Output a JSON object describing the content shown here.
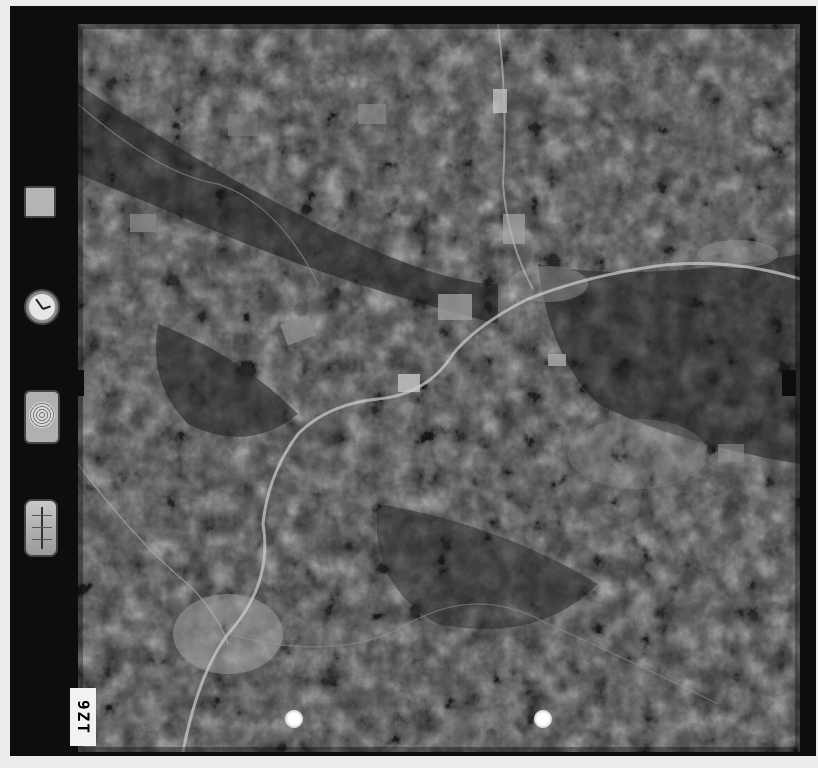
{
  "photo": {
    "type": "aerial-survey-photograph",
    "tone": "grayscale",
    "features": [
      "river",
      "town",
      "forested-hills",
      "farm-fields",
      "roads"
    ]
  },
  "frame_number": "9ZT",
  "instruments": {
    "label_text": "",
    "clock_icon": "clock-icon",
    "altimeter_icon": "altimeter-icon",
    "level_icon": "level-bubble-icon"
  },
  "colors": {
    "frame": "#0d0d0d",
    "border": "#ececec",
    "river": "#cfcfcf",
    "town": "#9e9e9e"
  }
}
